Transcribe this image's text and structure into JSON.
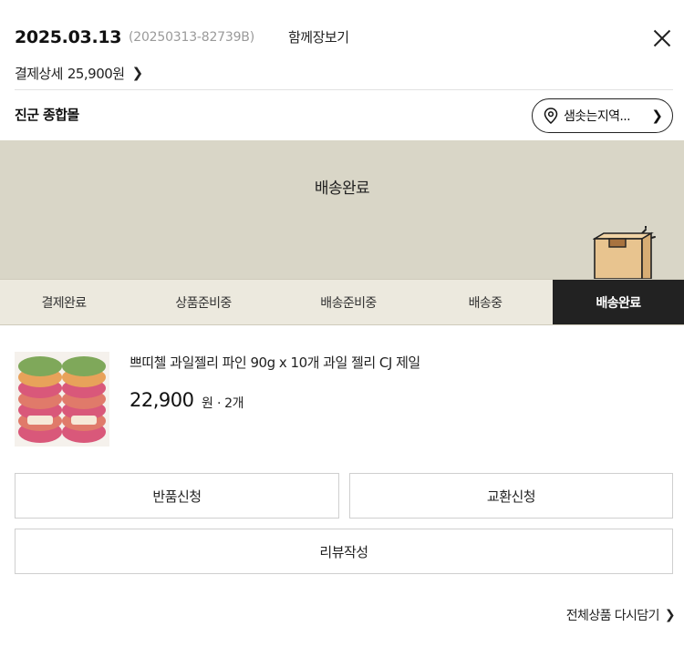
{
  "header": {
    "order_date": "2025.03.13",
    "order_number": "(20250313-82739B)",
    "together_view": "함께장보기"
  },
  "payment": {
    "label": "결제상세",
    "amount": "25,900원"
  },
  "store": {
    "name": "진군 종합몰",
    "region_label": "샘솟는지역..."
  },
  "banner": {
    "status": "배송완료"
  },
  "steps": [
    {
      "label": "결제완료",
      "active": false
    },
    {
      "label": "상품준비중",
      "active": false
    },
    {
      "label": "배송준비중",
      "active": false
    },
    {
      "label": "배송중",
      "active": false
    },
    {
      "label": "배송완료",
      "active": true
    }
  ],
  "product": {
    "name": "쁘띠첼 과일젤리 파인 90g x 10개 과일 젤리 CJ 제일",
    "price": "22,900",
    "unit": "원",
    "quantity": "· 2개"
  },
  "actions": {
    "return_label": "반품신청",
    "exchange_label": "교환신청",
    "review_label": "리뷰작성",
    "readd_label": "전체상품 다시담기"
  },
  "colors": {
    "banner_bg": "#d9d6c7",
    "active_step_bg": "#222222",
    "box_color": "#e8c48f"
  }
}
